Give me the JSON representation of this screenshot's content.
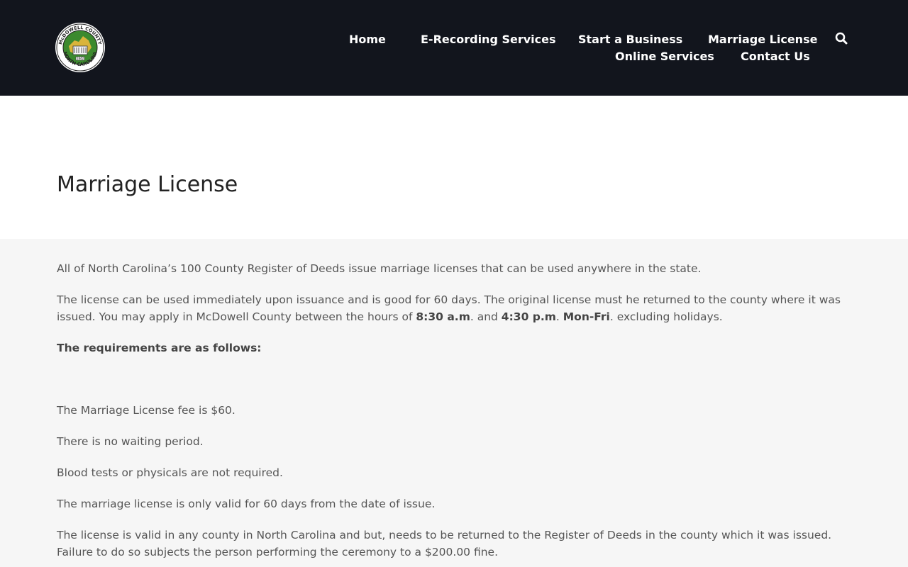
{
  "logo": {
    "alt": "McDowell County North Carolina seal",
    "top_text": "McDOWELL COUNTY",
    "bottom_text": "NORTH CAROLINA",
    "year": "1842"
  },
  "nav": {
    "items": [
      {
        "label": "Home"
      },
      {
        "label": "E-Recording Services"
      },
      {
        "label": "Start a Business"
      },
      {
        "label": "Marriage License"
      },
      {
        "label": "Online Services"
      },
      {
        "label": "Contact Us"
      }
    ],
    "search_icon": "search-icon"
  },
  "page": {
    "title": "Marriage License"
  },
  "content": {
    "intro": "All of North Carolina’s 100 County Register of Deeds issue marriage licenses that can be used anywhere in the state.",
    "p2": {
      "a": "The license can be used immediately upon issuance and is good for 60 days. The original license must he returned to the county where it was issued. You may apply in McDowell County between the hours of ",
      "start_time": "8:30 a.m",
      "b": ". and ",
      "end_time": "4:30 p.m",
      "c": ". ",
      "days": "Mon-Fri",
      "d": ". excluding holidays."
    },
    "requirements_heading": "The requirements are as follows:",
    "fee": "The Marriage License fee is $60.",
    "waiting": "There is no waiting period.",
    "blood": "Blood tests or physicals are not required.",
    "validity": "The marriage license is only valid for 60 days from the date of issue.",
    "return": "The license is valid in any county in North Carolina and but, needs to be returned to the Register of Deeds in the county which it was issued. Failure to do so subjects the person performing the ceremony to a $200.00 fine."
  },
  "colors": {
    "header_bg": "#12151d",
    "seal_green": "#3c8a2e",
    "seal_gold": "#d9b43a"
  }
}
